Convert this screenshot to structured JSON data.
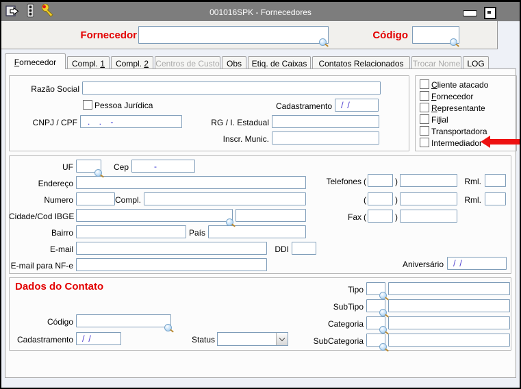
{
  "window": {
    "title": "001016SPK - Fornecedores"
  },
  "icons": {
    "titlebar": [
      "exit-icon",
      "traffic-light-icon",
      "wrench-icon"
    ],
    "window_controls": [
      "minimize-icon",
      "maximize-icon"
    ],
    "lookup": "magnifier-icon",
    "combo": "chevron-down-icon",
    "callout": "red-arrow-left-icon"
  },
  "colors": {
    "accent_red": "#e30000",
    "arrow_red": "#ee1111",
    "mask_blue": "#2828cf",
    "mask_violet": "#5040d0",
    "input_border": "#7f9db9",
    "titlebar_gray": "#7d7d7d"
  },
  "header": {
    "fornecedor": "Fornecedor",
    "codigo": "Código"
  },
  "tabs": [
    {
      "pre": "",
      "u": "F",
      "post": "ornecedor",
      "state": "active"
    },
    {
      "pre": "Compl. ",
      "u": "1",
      "post": "",
      "state": "enabled"
    },
    {
      "pre": "Compl. ",
      "u": "2",
      "post": "",
      "state": "enabled"
    },
    {
      "pre": "Centros de Custo",
      "u": "",
      "post": "",
      "state": "disabled"
    },
    {
      "pre": "Obs",
      "u": "",
      "post": "",
      "state": "enabled"
    },
    {
      "pre": "Etiq. de Caixas",
      "u": "",
      "post": "",
      "state": "enabled"
    },
    {
      "pre": "Contatos Relacionados",
      "u": "",
      "post": "",
      "state": "enabled"
    },
    {
      "pre": "Trocar Nome",
      "u": "",
      "post": "",
      "state": "disabled"
    },
    {
      "pre": "LOG",
      "u": "",
      "post": "",
      "state": "enabled"
    }
  ],
  "section1": {
    "razao_social": "Razão Social",
    "pessoa_juridica": "Pessoa Jurídica",
    "cadastramento": "Cadastramento",
    "cadastramento_value": "/ /",
    "cnpj_cpf": "CNPJ / CPF",
    "cnpj_value": ". . -",
    "rg": "RG / I. Estadual",
    "inscr_munic": "Inscr. Munic."
  },
  "flags": [
    {
      "pre": "",
      "u": "C",
      "post": "liente atacado",
      "checked": false
    },
    {
      "pre": "",
      "u": "F",
      "post": "ornecedor",
      "checked": false
    },
    {
      "pre": "",
      "u": "R",
      "post": "epresentante",
      "checked": false
    },
    {
      "pre": "Fi",
      "u": "l",
      "post": "ial",
      "checked": false
    },
    {
      "pre": "Transportadora",
      "u": "",
      "post": "",
      "checked": false
    },
    {
      "pre": "Intermediador",
      "u": "",
      "post": "",
      "checked": false
    }
  ],
  "address": {
    "uf": "UF",
    "cep": "Cep",
    "cep_value": "-",
    "endereco": "Endereço",
    "numero": "Numero",
    "compl": "Compl.",
    "cidade": "Cidade/Cod IBGE",
    "bairro": "Bairro",
    "pais": "País",
    "email": "E-mail",
    "ddi": "DDI",
    "email_nfe": "E-mail para NF-e",
    "telefones": "Telefones",
    "rml1": "Rml.",
    "rml2": "Rml.",
    "fax": "Fax",
    "aniversario": "Aniversário",
    "aniversario_value": "/ /",
    "paren_open": "(",
    "paren_close": ")"
  },
  "contact": {
    "title": "Dados do Contato",
    "tipo": "Tipo",
    "subtipo": "SubTipo",
    "categoria": "Categoria",
    "subcategoria": "SubCategoria",
    "codigo": "Código",
    "cadastramento": "Cadastramento",
    "cadastramento_value": "/ /",
    "status": "Status"
  }
}
